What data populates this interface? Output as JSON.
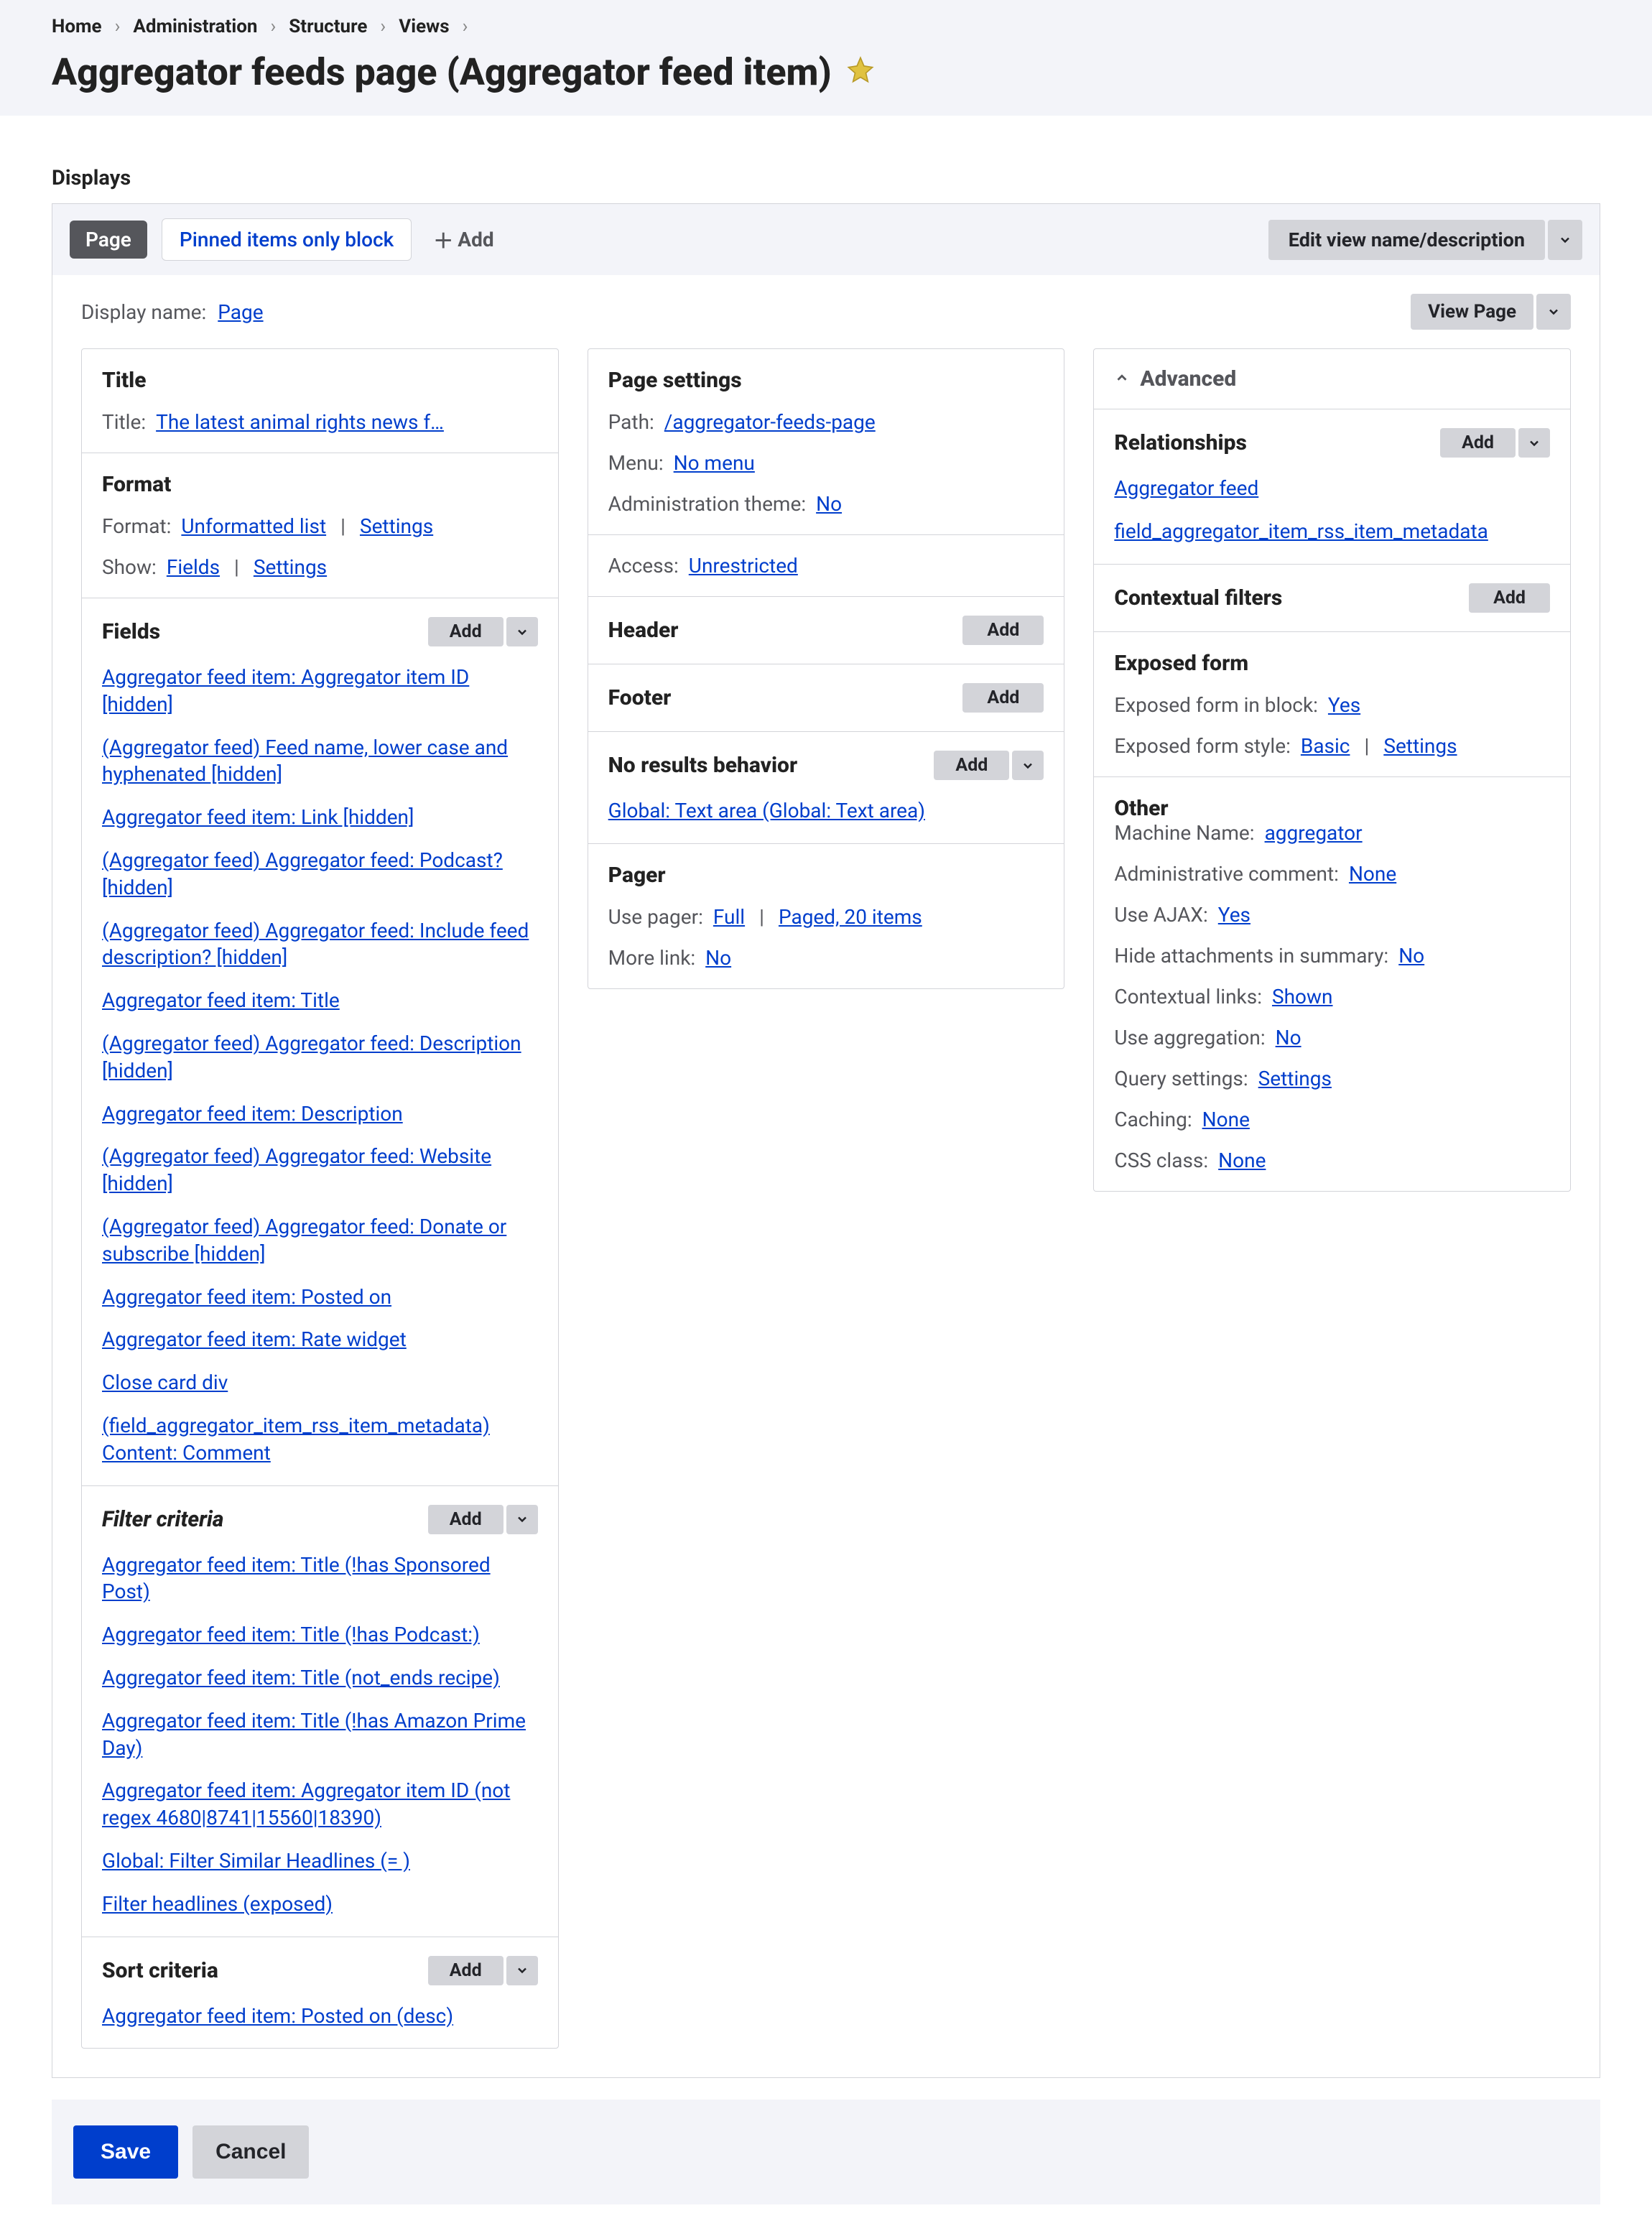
{
  "breadcrumbs": [
    "Home",
    "Administration",
    "Structure",
    "Views"
  ],
  "page_title": "Aggregator feeds page (Aggregator feed item)",
  "displays_label": "Displays",
  "tabs": {
    "active": "Page",
    "secondary": "Pinned items only block",
    "add": "Add"
  },
  "edit_view_btn": "Edit view name/description",
  "display_name_label": "Display name:",
  "display_name_value": "Page",
  "view_page_btn": "View Page",
  "col1": {
    "title_section": {
      "heading": "Title",
      "title_label": "Title:",
      "title_value": "The latest animal rights news f…"
    },
    "format_section": {
      "heading": "Format",
      "format_label": "Format:",
      "format_value": "Unformatted list",
      "format_settings": "Settings",
      "show_label": "Show:",
      "show_value": "Fields",
      "show_settings": "Settings"
    },
    "fields_section": {
      "heading": "Fields",
      "add": "Add",
      "items": [
        "Aggregator feed item: Aggregator item ID [hidden]",
        "(Aggregator feed) Feed name, lower case and hyphenated [hidden]",
        "Aggregator feed item: Link [hidden]",
        "(Aggregator feed) Aggregator feed: Podcast? [hidden]",
        "(Aggregator feed) Aggregator feed: Include feed description? [hidden]",
        "Aggregator feed item: Title",
        "(Aggregator feed) Aggregator feed: Description [hidden]",
        "Aggregator feed item: Description",
        "(Aggregator feed) Aggregator feed: Website [hidden]",
        "(Aggregator feed) Aggregator feed: Donate or subscribe [hid­den]",
        "Aggregator feed item: Posted on",
        "Aggregator feed item: Rate widget",
        "Close card div",
        "(field_aggregator_item_rss_item_metadata) Content: Comment"
      ]
    },
    "filter_section": {
      "heading": "Filter criteria",
      "add": "Add",
      "items": [
        "Aggregator feed item: Title (!has Sponsored Post)",
        "Aggregator feed item: Title (!has Podcast:)",
        "Aggregator feed item: Title (not_ends recipe)",
        "Aggregator feed item: Title (!has Amazon Prime Day)",
        "Aggregator feed item: Aggregator item ID (not regex 4680|8741|15560|18390)",
        "Global: Filter Similar Headlines (= )",
        "Filter headlines (exposed)"
      ]
    },
    "sort_section": {
      "heading": "Sort criteria",
      "add": "Add",
      "items": [
        "Aggregator feed item: Posted on (desc)"
      ]
    }
  },
  "col2": {
    "page_settings": {
      "heading": "Page settings",
      "path_label": "Path:",
      "path_value": "/aggregator-feeds-page",
      "menu_label": "Menu:",
      "menu_value": "No menu",
      "admin_theme_label": "Administration theme:",
      "admin_theme_value": "No"
    },
    "access": {
      "label": "Access:",
      "value": "Unrestricted"
    },
    "header": {
      "heading": "Header",
      "add": "Add"
    },
    "footer": {
      "heading": "Footer",
      "add": "Add"
    },
    "no_results": {
      "heading": "No results behavior",
      "add": "Add",
      "items": [
        "Global: Text area (Global: Text area)"
      ]
    },
    "pager": {
      "heading": "Pager",
      "use_pager_label": "Use pager:",
      "use_pager_value": "Full",
      "pager_paged": "Paged, 20 items",
      "more_label": "More link:",
      "more_value": "No"
    }
  },
  "col3": {
    "advanced": "Advanced",
    "relationships": {
      "heading": "Relationships",
      "add": "Add",
      "items": [
        "Aggregator feed",
        "field_aggregator_item_rss_item_metadata"
      ]
    },
    "contextual": {
      "heading": "Contextual filters",
      "add": "Add"
    },
    "exposed": {
      "heading": "Exposed form",
      "block_label": "Exposed form in block:",
      "block_value": "Yes",
      "style_label": "Exposed form style:",
      "style_value": "Basic",
      "style_settings": "Settings"
    },
    "other": {
      "heading": "Other",
      "rows": [
        {
          "label": "Machine Name:",
          "value": "aggregator"
        },
        {
          "label": "Administrative comment:",
          "value": "None"
        },
        {
          "label": "Use AJAX:",
          "value": "Yes"
        },
        {
          "label": "Hide attachments in summary:",
          "value": "No"
        },
        {
          "label": "Contextual links:",
          "value": "Shown"
        },
        {
          "label": "Use aggregation:",
          "value": "No"
        },
        {
          "label": "Query settings:",
          "value": "Settings"
        },
        {
          "label": "Caching:",
          "value": "None"
        },
        {
          "label": "CSS class:",
          "value": "None"
        }
      ]
    }
  },
  "actions": {
    "save": "Save",
    "cancel": "Cancel"
  }
}
